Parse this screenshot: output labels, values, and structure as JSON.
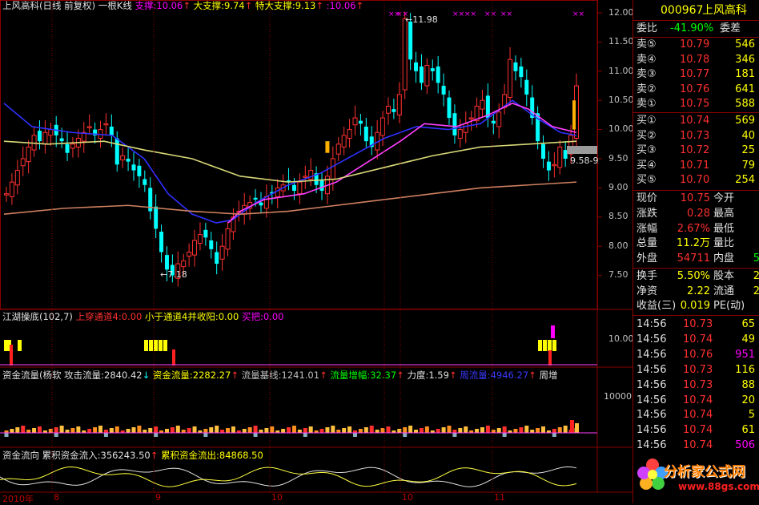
{
  "main": {
    "title": "上风高科(日线 前复权)",
    "subtitle": "一根K线",
    "support_label": "支撑:",
    "support": "10.06",
    "big_support_label": "大支撑:",
    "big_support": "9.74",
    "super_support_label": "特大支撑:",
    "super_support": "9.13",
    "last_label": ":",
    "last": "10.06",
    "arrow": "↑",
    "high_mark": "11.98",
    "low_mark": "7.18",
    "range_mark": "9.58-9",
    "y_ticks": [
      "12.00",
      "11.50",
      "11.00",
      "10.50",
      "10.00",
      "9.50",
      "9.00",
      "8.50",
      "8.00",
      "7.50"
    ]
  },
  "ind1": {
    "name": "江湖操底(102,7)",
    "l1": "上穿通道4:0.00",
    "l2": "小于通道4并收阳:0.00",
    "l3": "买把:0.00",
    "y_tick": "10.00"
  },
  "ind2": {
    "name": "资金流量(杨软",
    "l1": "攻击流量:2840.42",
    "l2": "资金流量:2282.27",
    "l3": "流量基线:1241.01",
    "l4": "流量增幅:32.37",
    "l5": "力度:1.59",
    "l6": "周流量:4946.27",
    "l7": "周增",
    "down": "↓",
    "up": "↑",
    "y_tick": "10000"
  },
  "ind3": {
    "name": "资金流向",
    "l1": "累积资金流入:356243.50",
    "l2": "累积资金流出:84868.50",
    "up": "↑"
  },
  "axis": {
    "year": "2010年",
    "m8": "8",
    "m9": "9",
    "m10": "10",
    "m11": "11"
  },
  "quote": {
    "code": "000967",
    "name": "上风高科",
    "weibi_label": "委比",
    "weibi": "-41.90%",
    "weicha_label": "委差",
    "asks": [
      {
        "label": "卖⑤",
        "price": "10.79",
        "vol": "546"
      },
      {
        "label": "卖④",
        "price": "10.78",
        "vol": "346"
      },
      {
        "label": "卖③",
        "price": "10.77",
        "vol": "181"
      },
      {
        "label": "卖②",
        "price": "10.76",
        "vol": "641"
      },
      {
        "label": "卖①",
        "price": "10.75",
        "vol": "588"
      }
    ],
    "bids": [
      {
        "label": "买①",
        "price": "10.74",
        "vol": "569"
      },
      {
        "label": "买②",
        "price": "10.73",
        "vol": "40"
      },
      {
        "label": "买③",
        "price": "10.72",
        "vol": "25"
      },
      {
        "label": "买④",
        "price": "10.71",
        "vol": "79"
      },
      {
        "label": "买⑤",
        "price": "10.70",
        "vol": "254"
      }
    ],
    "stats1": [
      {
        "l": "现价",
        "v": "10.75",
        "r": "今开"
      },
      {
        "l": "涨跌",
        "v": "0.28",
        "r": "最高"
      },
      {
        "l": "涨幅",
        "v": "2.67%",
        "r": "最低"
      },
      {
        "l": "总量",
        "v": "11.2万",
        "r": "量比"
      },
      {
        "l": "外盘",
        "v": "54711",
        "r": "内盘",
        "rv": "5"
      }
    ],
    "stats2": [
      {
        "l": "换手",
        "v": "5.50%",
        "r": "股本",
        "rv": "2"
      },
      {
        "l": "净资",
        "v": "2.22",
        "r": "流通",
        "rv": "2"
      },
      {
        "l": "收益(三)",
        "v": "0.019",
        "r": "PE(动)"
      }
    ],
    "ticks": [
      {
        "t": "14:56",
        "p": "10.73",
        "v": "65"
      },
      {
        "t": "14:56",
        "p": "10.74",
        "v": "49"
      },
      {
        "t": "14:56",
        "p": "10.76",
        "v": "951"
      },
      {
        "t": "14:56",
        "p": "10.73",
        "v": "116"
      },
      {
        "t": "14:56",
        "p": "10.73",
        "v": "88"
      },
      {
        "t": "14:56",
        "p": "10.74",
        "v": "20"
      },
      {
        "t": "14:56",
        "p": "10.74",
        "v": "5"
      },
      {
        "t": "14:56",
        "p": "10.74",
        "v": "61"
      },
      {
        "t": "14:56",
        "p": "10.74",
        "v": "506"
      }
    ],
    "watermark": "分析家公式网",
    "watermark_url": "www.88gs.com"
  }
}
